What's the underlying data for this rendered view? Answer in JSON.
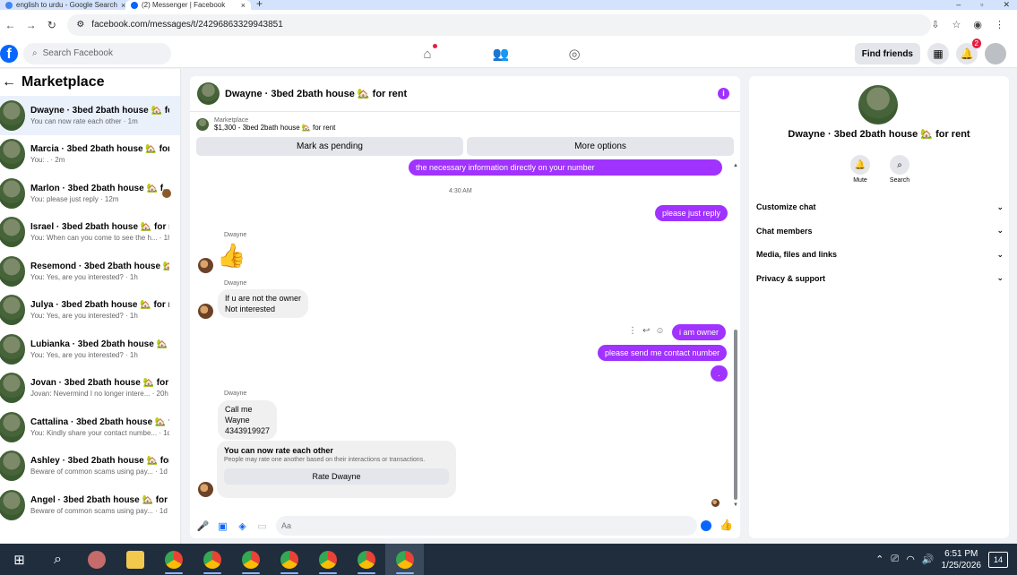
{
  "browser": {
    "tabs": [
      {
        "title": "english to urdu - Google Search",
        "color": "#4285f4"
      },
      {
        "title": "(2) Messenger | Facebook",
        "color": "#0866ff"
      }
    ],
    "url": "facebook.com/messages/t/24296863329943851"
  },
  "fb": {
    "search_placeholder": "Search Facebook",
    "find_friends": "Find friends",
    "notification_count": "2"
  },
  "sidebar": {
    "title": "Marketplace",
    "conversations": [
      {
        "name": "Dwayne · 3bed 2bath house 🏡 for...",
        "preview": "You can now rate each other · 1m"
      },
      {
        "name": "Marcia · 3bed 2bath house 🏡 for ...",
        "preview": "You: . · 2m"
      },
      {
        "name": "Marlon · 3bed 2bath house 🏡 f...",
        "preview": "You: please just reply · 12m"
      },
      {
        "name": "Israel · 3bed 2bath house 🏡 for re...",
        "preview": "You: When can you come to see the h... · 1h"
      },
      {
        "name": "Resemond · 3bed 2bath house 🏡 ...",
        "preview": "You: Yes, are you interested? · 1h"
      },
      {
        "name": "Julya · 3bed 2bath house 🏡 for rent",
        "preview": "You: Yes, are you interested? · 1h"
      },
      {
        "name": "Lubianka · 3bed 2bath house 🏡 f...",
        "preview": "You: Yes, are you interested? · 1h"
      },
      {
        "name": "Jovan · 3bed 2bath house 🏡 for r...",
        "preview": "Jovan: Nevermind I no longer intere... · 20h"
      },
      {
        "name": "Cattalina · 3bed 2bath house 🏡 fo...",
        "preview": "You: Kindly share your contact numbe... · 1d"
      },
      {
        "name": "Ashley · 3bed 2bath house 🏡 for r...",
        "preview": "Beware of common scams using pay... · 1d"
      },
      {
        "name": "Angel · 3bed 2bath house 🏡 for r...",
        "preview": "Beware of common scams using pay... · 1d"
      }
    ]
  },
  "chat": {
    "title": "Dwayne · 3bed 2bath house 🏡 for rent",
    "marketplace_label": "Marketplace",
    "listing": "$1,300 - 3bed 2bath house 🏡 for rent",
    "mark_pending": "Mark as pending",
    "more_options": "More options",
    "messages": {
      "out_partial": "the necessary information directly on your number",
      "time": "4:30 AM",
      "out_reply": "please just reply",
      "sender1": "Dwayne",
      "sender2": "Dwayne",
      "in_owner_line1": "If u are not the owner",
      "in_owner_line2": "Not interested",
      "out_owner": "i am owner",
      "out_contact": "please send me contact number",
      "out_dot": ".",
      "sender3": "Dwayne",
      "in_call1": "Call me",
      "in_call2": "Wayne",
      "in_call3": "4343919927"
    },
    "rate": {
      "title": "You can now rate each other",
      "subtitle": "People may rate one another based on their interactions or transactions.",
      "button": "Rate Dwayne"
    },
    "composer_placeholder": "Aa"
  },
  "info_panel": {
    "name": "Dwayne · 3bed 2bath house 🏡 for rent",
    "mute": "Mute",
    "search": "Search",
    "sections": [
      "Customize chat",
      "Chat members",
      "Media, files and links",
      "Privacy & support"
    ]
  },
  "taskbar": {
    "time": "6:51 PM",
    "date": "1/25/2026",
    "notifications": "14"
  }
}
